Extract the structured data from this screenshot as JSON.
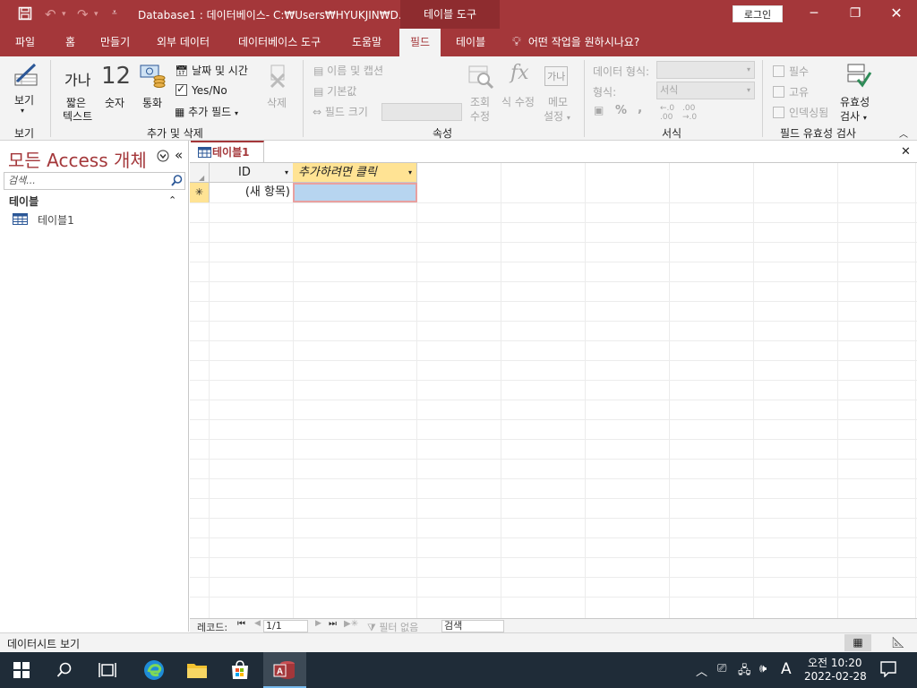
{
  "titlebar": {
    "title": "Database1 : 데이터베이스- C:₩Users₩HYUKJIN₩D...",
    "context_tab": "테이블 도구",
    "login": "로그인"
  },
  "tabs": [
    "파일",
    "홈",
    "만들기",
    "외부 데이터",
    "데이터베이스 도구",
    "도움말",
    "필드",
    "테이블"
  ],
  "tell_me": "어떤 작업을 원하시나요?",
  "ribbon": {
    "view": {
      "label": "보기",
      "group": "보기"
    },
    "add_delete": {
      "ganada": "가나",
      "short_text_1": "짧은",
      "short_text_2": "텍스트",
      "num_big": "12",
      "number": "숫자",
      "currency": "통화",
      "date_time": "날짜 및 시간",
      "yes_no": "Yes/No",
      "more_fields": "추가 필드",
      "delete": "삭제",
      "group": "추가 및 삭제"
    },
    "properties": {
      "name_caption": "이름 및 캡션",
      "default_value": "기본값",
      "field_size": "필드 크기",
      "lookup_1": "조회",
      "lookup_2": "수정",
      "expression": "식 수정",
      "memo_icon": "가나",
      "memo_1": "메모",
      "memo_2": "설정",
      "group": "속성"
    },
    "formatting": {
      "data_type": "데이터 형식:",
      "format": "형식:",
      "format_value": "서식",
      "percent": "%",
      "comma": ",",
      "group": "서식"
    },
    "validation": {
      "required": "필수",
      "unique": "고유",
      "indexed": "인덱싱됨",
      "validation_1": "유효성",
      "validation_2": "검사",
      "group": "필드 유효성 검사"
    }
  },
  "nav": {
    "title": "모든 Access 개체",
    "search_placeholder": "검색...",
    "group": "테이블",
    "item": "테이블1"
  },
  "document": {
    "tab": "테이블1",
    "col_id": "ID",
    "col_add": "추가하려면 클릭",
    "new_row": "(새 항목)",
    "new_row_marker": "✳"
  },
  "record_nav": {
    "label": "레코드:",
    "position": "1/1",
    "filter": "필터 없음",
    "search": "검색"
  },
  "status": {
    "text": "데이터시트 보기"
  },
  "taskbar": {
    "time": "오전 10:20",
    "date": "2022-02-28",
    "ime": "A"
  }
}
